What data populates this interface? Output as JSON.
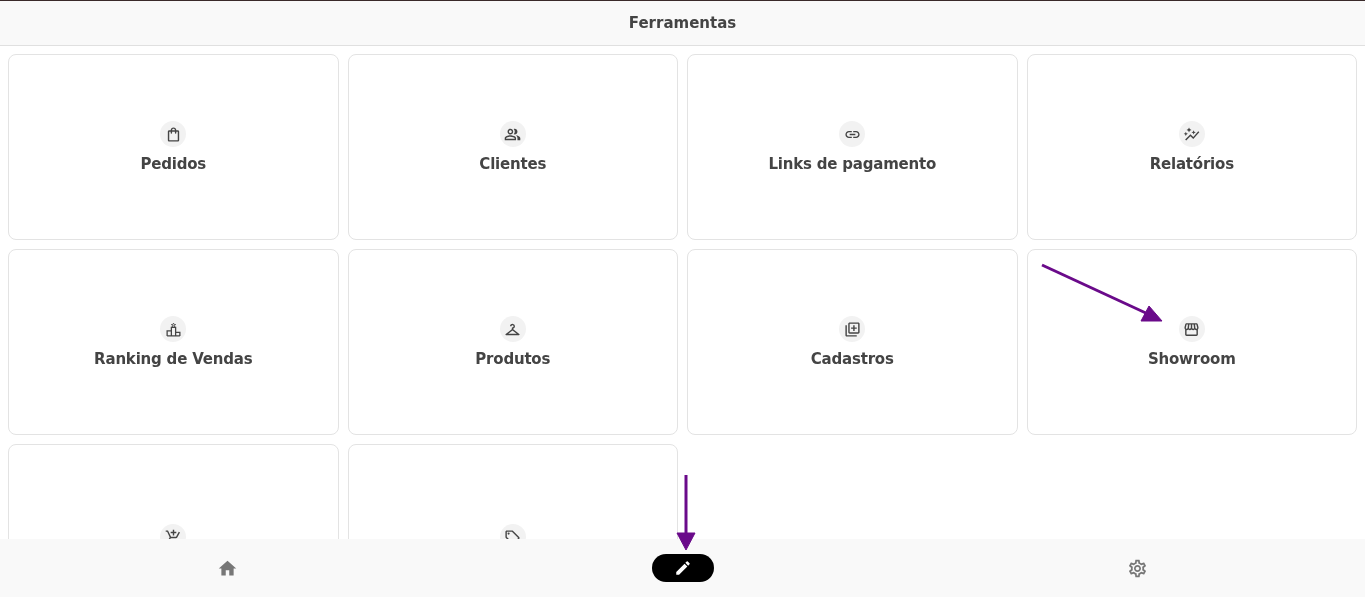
{
  "header": {
    "title": "Ferramentas"
  },
  "tools": [
    {
      "kind": "labeled",
      "label": "Pedidos"
    },
    {
      "kind": "labeled",
      "label": "Clientes"
    },
    {
      "kind": "labeled",
      "label": "Links de pagamento"
    },
    {
      "kind": "labeled",
      "label": "Relatórios"
    },
    {
      "kind": "labeled",
      "label": "Ranking de Vendas"
    },
    {
      "kind": "labeled",
      "label": "Produtos"
    },
    {
      "kind": "labeled",
      "label": "Cadastros"
    },
    {
      "kind": "labeled",
      "label": "Showroom"
    },
    {
      "kind": "cut_off"
    },
    {
      "kind": "cut_off"
    }
  ],
  "bottom_nav": [
    {
      "selected": false
    },
    {
      "selected": true
    },
    {
      "selected": false
    }
  ]
}
